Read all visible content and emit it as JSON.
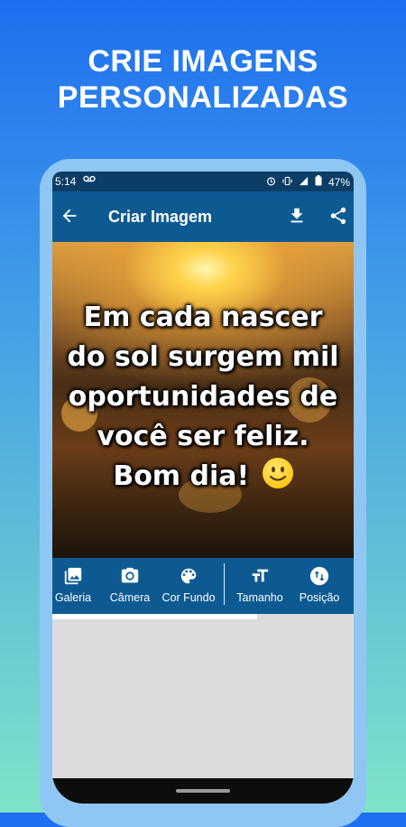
{
  "headline": {
    "line1": "CRIE IMAGENS",
    "line2": "PERSONALIZADAS"
  },
  "status_bar": {
    "time": "5:14",
    "voicemail_icon": "voicemail-icon",
    "battery": "47%"
  },
  "app_bar": {
    "title": "Criar Imagem",
    "back_icon": "arrow-back-icon",
    "download_icon": "download-icon",
    "share_icon": "share-icon"
  },
  "quote": {
    "lines": [
      "Em cada nascer",
      "do sol surgem mil",
      "oportunidades de",
      "você ser feliz.",
      "Bom dia!"
    ]
  },
  "toolbar": {
    "items": [
      {
        "label": "Galeria",
        "icon": "gallery-icon"
      },
      {
        "label": "Câmera",
        "icon": "camera-icon"
      },
      {
        "label": "Cor Fundo",
        "icon": "palette-icon"
      },
      {
        "label": "Tamanho",
        "icon": "text-size-icon"
      },
      {
        "label": "Posição",
        "icon": "swap-vertical-icon"
      }
    ]
  },
  "progress": {
    "fraction": 0.68
  },
  "colors": {
    "app_bar": "#0d5a92",
    "status_bar": "#0c3d66",
    "background_top": "#1e6ff0",
    "background_bottom": "#7fe3c8"
  }
}
